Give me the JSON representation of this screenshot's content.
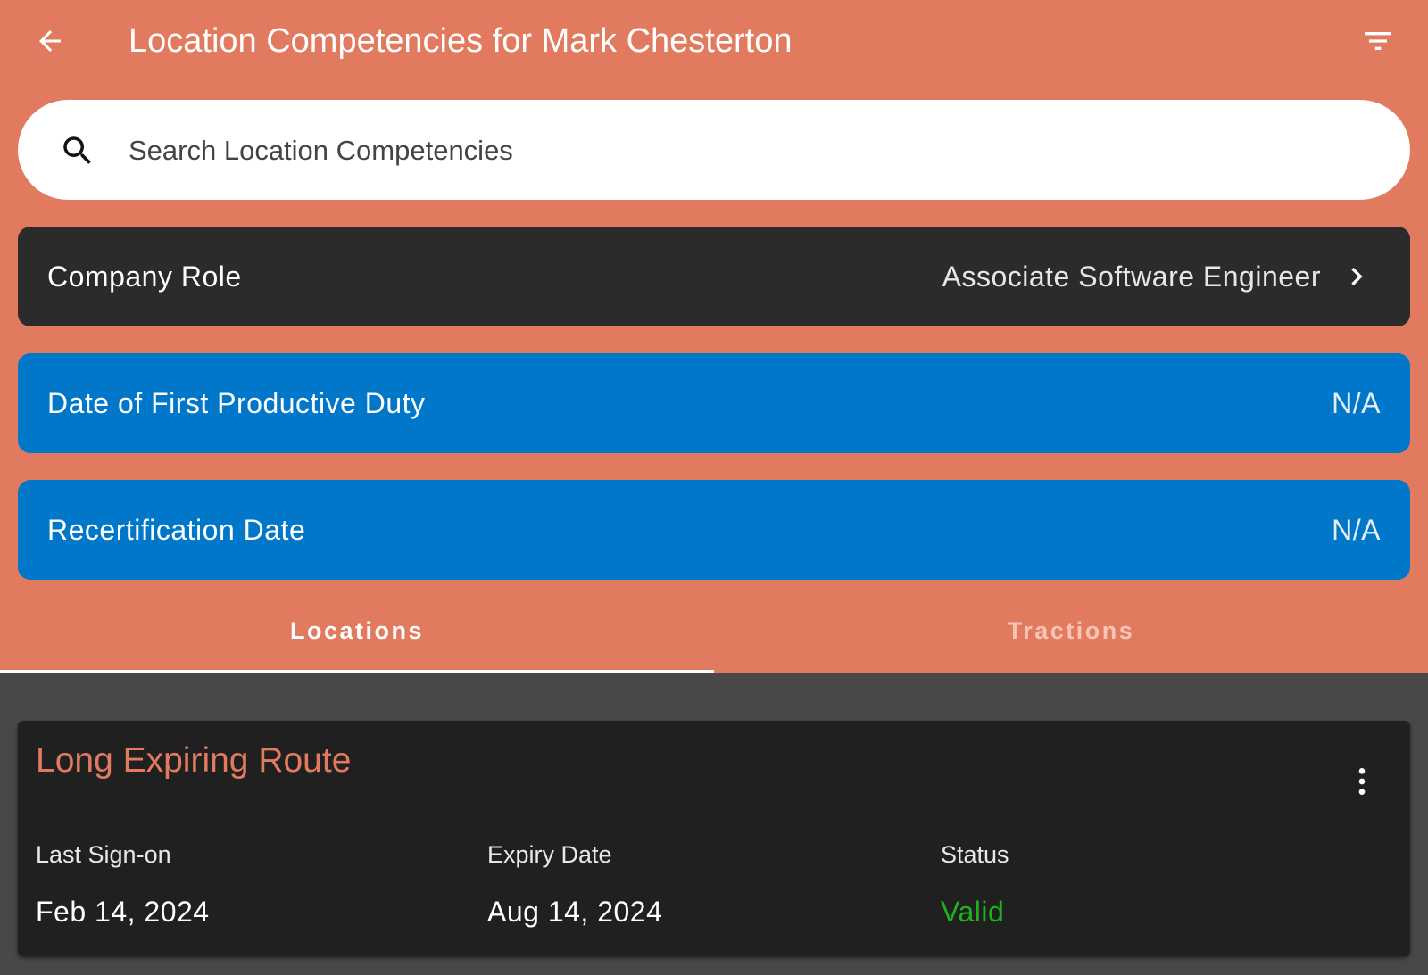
{
  "appbar": {
    "title": "Location Competencies for Mark Chesterton",
    "back_icon": "arrow-left-icon",
    "filter_icon": "filter-list-icon"
  },
  "search": {
    "placeholder": "Search Location Competencies",
    "value": "",
    "icon": "search-icon"
  },
  "company_role": {
    "label": "Company Role",
    "value": "Associate Software Engineer",
    "icon": "chevron-right-icon"
  },
  "first_productive_duty": {
    "label": "Date of First Productive Duty",
    "value": "N/A"
  },
  "recertification": {
    "label": "Recertification Date",
    "value": "N/A"
  },
  "tabs": [
    {
      "label": "Locations",
      "selected": true
    },
    {
      "label": "Tractions",
      "selected": false
    }
  ],
  "cards": [
    {
      "title": "Long Expiring Route",
      "menu_icon": "more-vert-icon",
      "columns": [
        {
          "header": "Last Sign-on",
          "value": "Feb 14, 2024"
        },
        {
          "header": "Expiry Date",
          "value": "Aug 14, 2024"
        },
        {
          "header": "Status",
          "value": "Valid"
        }
      ]
    }
  ],
  "colors": {
    "header_bg": "#E27A5F",
    "role_row_bg": "#2B2B2B",
    "date_row_bg": "#0077C8",
    "content_bg": "#484848",
    "card_bg": "#202020",
    "card_title": "#E27A5F",
    "status_valid": "#1DB31D"
  }
}
